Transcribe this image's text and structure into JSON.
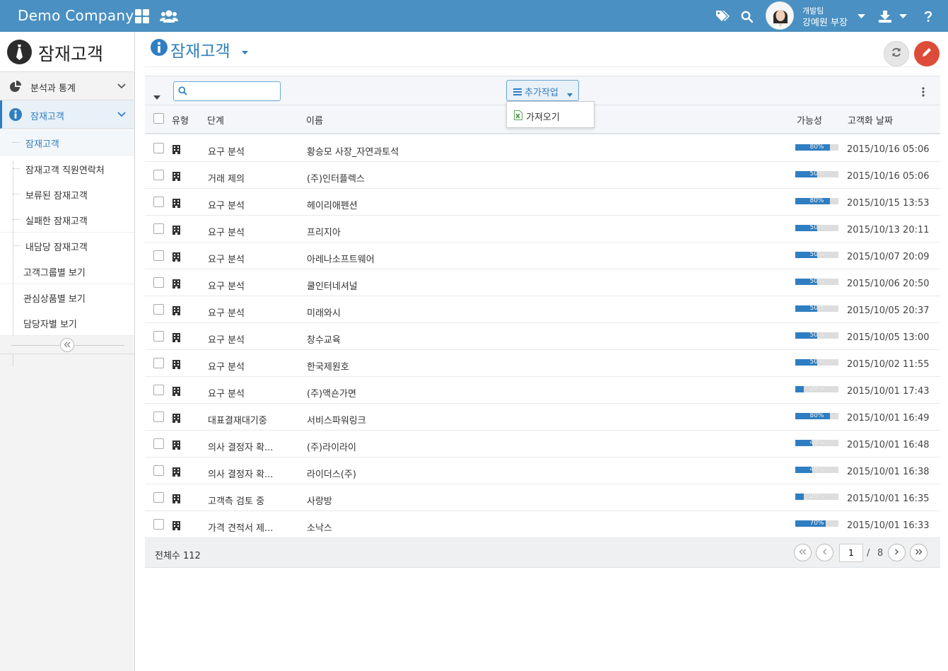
{
  "header": {
    "brand": "Demo Company",
    "user_team": "개발팀",
    "user_name": "강예원 부장"
  },
  "sidebar": {
    "title": "잠재고객",
    "sections": [
      {
        "label": "분석과 통계"
      },
      {
        "label": "잠재고객"
      }
    ],
    "items": [
      {
        "label": "잠재고객"
      },
      {
        "label": "잠재고객 직원연락처"
      },
      {
        "label": "보류된 잠재고객"
      },
      {
        "label": "실패한 잠재고객"
      },
      {
        "label": "내담당 잠재고객"
      },
      {
        "label": "고객그룹별 보기"
      },
      {
        "label": "관심상품별 보기"
      },
      {
        "label": "담당자별 보기"
      }
    ]
  },
  "page": {
    "title": "잠재고객"
  },
  "toolbar": {
    "search_placeholder": "",
    "more_actions_label": "추가작업",
    "dropdown_items": [
      {
        "label": "가져오기"
      }
    ]
  },
  "table": {
    "columns": [
      "유형",
      "단계",
      "이름",
      "가능성",
      "고객화 날짜"
    ],
    "rows": [
      {
        "stage": "요구 분석",
        "name": "황승모 사장_자연과토석",
        "prob": 80,
        "prob_label": "80%",
        "date": "2015/10/16 05:06"
      },
      {
        "stage": "거래 제의",
        "name": "(주)인터플렉스",
        "prob": 50,
        "prob_label": "50%",
        "date": "2015/10/16 05:06"
      },
      {
        "stage": "요구 분석",
        "name": "헤이리애펜션",
        "prob": 80,
        "prob_label": "80%",
        "date": "2015/10/15 13:53"
      },
      {
        "stage": "요구 분석",
        "name": "프리지아",
        "prob": 50,
        "prob_label": "50%",
        "date": "2015/10/13 20:11"
      },
      {
        "stage": "요구 분석",
        "name": "아레나소프트웨어",
        "prob": 50,
        "prob_label": "50%",
        "date": "2015/10/07 20:09"
      },
      {
        "stage": "요구 분석",
        "name": "쿨인터네셔널",
        "prob": 50,
        "prob_label": "50%",
        "date": "2015/10/06 20:50"
      },
      {
        "stage": "요구 분석",
        "name": "미래와시",
        "prob": 50,
        "prob_label": "50%",
        "date": "2015/10/05 20:37"
      },
      {
        "stage": "요구 분석",
        "name": "창수교육",
        "prob": 50,
        "prob_label": "50%",
        "date": "2015/10/05 13:00"
      },
      {
        "stage": "요구 분석",
        "name": "한국제원호",
        "prob": 50,
        "prob_label": "50%",
        "date": "2015/10/02 11:55"
      },
      {
        "stage": "요구 분석",
        "name": "(주)액숀가면",
        "prob": 20,
        "prob_label": "20%",
        "date": "2015/10/01 17:43"
      },
      {
        "stage": "대표결재대기중",
        "name": "서비스파워링크",
        "prob": 80,
        "prob_label": "80%",
        "date": "2015/10/01 16:49"
      },
      {
        "stage": "의사 결정자 확...",
        "name": "(주)라이라이",
        "prob": 40,
        "prob_label": "40%",
        "date": "2015/10/01 16:48"
      },
      {
        "stage": "의사 결정자 확...",
        "name": "라이더스(주)",
        "prob": 40,
        "prob_label": "40%",
        "date": "2015/10/01 16:38"
      },
      {
        "stage": "고객측 검토 중",
        "name": "사랑방",
        "prob": 20,
        "prob_label": "20%",
        "date": "2015/10/01 16:35"
      },
      {
        "stage": "가격 견적서 제...",
        "name": "소낙스",
        "prob": 70,
        "prob_label": "70%",
        "date": "2015/10/01 16:33"
      }
    ]
  },
  "footer": {
    "total_label": "전체수 112",
    "current_page": "1",
    "page_sep": "/",
    "total_pages": "8"
  },
  "colors": {
    "topbar": "#4a90c2",
    "accent": "#2f7ec1",
    "edit_button": "#dd4b39"
  },
  "icons": [
    "dashboard-grid-icon",
    "users-icon",
    "tags-icon",
    "search-icon",
    "caret-down-icon",
    "download-icon",
    "help-icon",
    "tie-icon",
    "info-icon",
    "pie-chart-icon",
    "chevron-down-icon",
    "double-left-icon",
    "refresh-icon",
    "pencil-icon",
    "menu-icon",
    "excel-file-icon",
    "building-icon",
    "vertical-dots-icon",
    "first-page-icon",
    "prev-page-icon",
    "next-page-icon",
    "last-page-icon"
  ]
}
